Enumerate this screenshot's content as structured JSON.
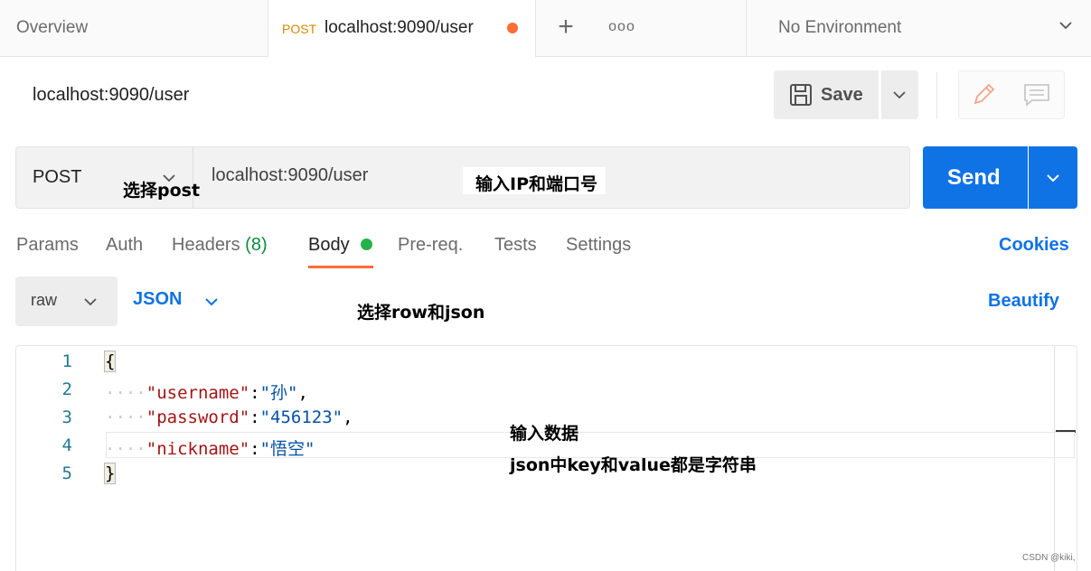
{
  "tabs": {
    "overview": "Overview",
    "active": {
      "method": "POST",
      "url": "localhost:9090/user"
    },
    "plus": "+",
    "more": "ooo"
  },
  "environment": {
    "label": "No Environment"
  },
  "request": {
    "title": "localhost:9090/user",
    "save_label": "Save",
    "method": "POST",
    "url": "localhost:9090/user",
    "send_label": "Send"
  },
  "req_tabs": {
    "params": "Params",
    "auth": "Auth",
    "headers": "Headers",
    "headers_count": "(8)",
    "body": "Body",
    "prereq": "Pre-req.",
    "tests": "Tests",
    "settings": "Settings",
    "cookies": "Cookies"
  },
  "body_options": {
    "mode": "raw",
    "format": "JSON",
    "beautify": "Beautify"
  },
  "editor": {
    "line_numbers": [
      "1",
      "2",
      "3",
      "4",
      "5"
    ],
    "open_brace": "{",
    "close_brace": "}",
    "ws": "····",
    "colon": ":",
    "comma": ",",
    "lines": [
      {
        "key": "\"username\"",
        "value": "\"孙\""
      },
      {
        "key": "\"password\"",
        "value": "\"456123\""
      },
      {
        "key": "\"nickname\"",
        "value": "\"悟空\""
      }
    ]
  },
  "annotations": {
    "select_post": "选择post",
    "input_ip": "输入IP和端口号",
    "select_row_json": "选择row和json",
    "input_data": "输入数据",
    "json_note": "json中key和value都是字符串"
  },
  "watermark": "CSDN @kiki,",
  "colors": {
    "accent_orange": "#ff6c37",
    "send_blue": "#0f73e6",
    "body_dot_green": "#26b24a",
    "method_orange": "#d98a00"
  }
}
